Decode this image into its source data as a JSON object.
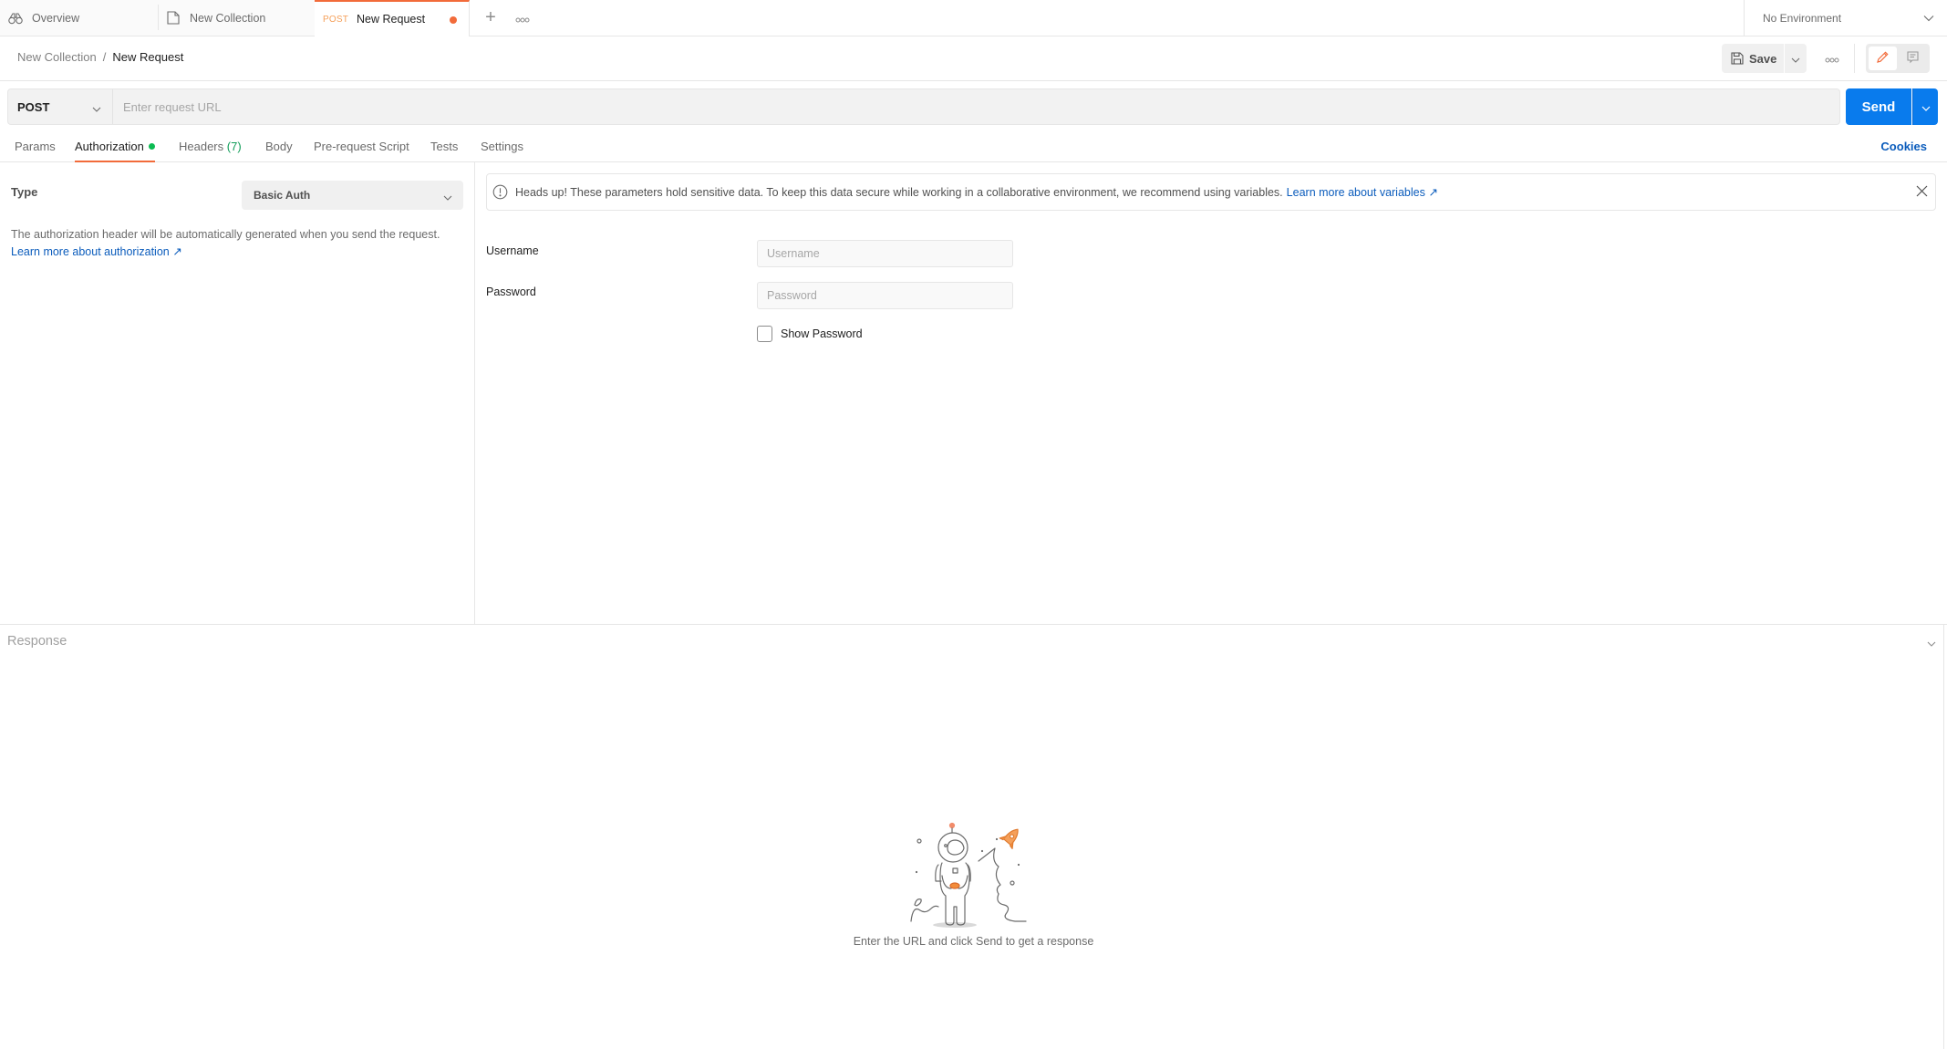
{
  "tabs": [
    {
      "label": "Overview",
      "icon": "binoculars-icon"
    },
    {
      "label": "New Collection",
      "icon": "collection-icon"
    },
    {
      "label": "New Request",
      "method": "POST",
      "unsaved": true,
      "active": true
    }
  ],
  "tabbar": {
    "add_label": "+",
    "more_icon": "more-horizontal-icon"
  },
  "environment": {
    "selected": "No Environment"
  },
  "breadcrumb": {
    "parent": "New Collection",
    "separator": "/",
    "current": "New Request"
  },
  "header": {
    "save_label": "Save"
  },
  "request": {
    "method": "POST",
    "url_value": "",
    "url_placeholder": "Enter request URL",
    "send_label": "Send"
  },
  "request_tabs": [
    {
      "label": "Params"
    },
    {
      "label": "Authorization",
      "active": true,
      "indicator": "green-dot"
    },
    {
      "label": "Headers",
      "count": "(7)"
    },
    {
      "label": "Body"
    },
    {
      "label": "Pre-request Script"
    },
    {
      "label": "Tests"
    },
    {
      "label": "Settings"
    }
  ],
  "cookies_label": "Cookies",
  "auth": {
    "type_label": "Type",
    "type_value": "Basic Auth",
    "description": "The authorization header will be automatically generated when you send the request.",
    "learn_more": "Learn more about authorization ↗",
    "warning_text": "Heads up! These parameters hold sensitive data. To keep this data secure while working in a collaborative environment, we recommend using variables.",
    "warning_link": "Learn more about variables ↗",
    "username_label": "Username",
    "username_placeholder": "Username",
    "username_value": "",
    "password_label": "Password",
    "password_placeholder": "Password",
    "password_value": "",
    "show_password_label": "Show Password",
    "show_password_checked": false
  },
  "response": {
    "title": "Response",
    "empty_message": "Enter the URL and click Send to get a response"
  },
  "colors": {
    "accent_orange": "#f26b3a",
    "send_blue": "#097bed",
    "link_blue": "#0b5cbc",
    "status_green": "#0cbb52"
  }
}
